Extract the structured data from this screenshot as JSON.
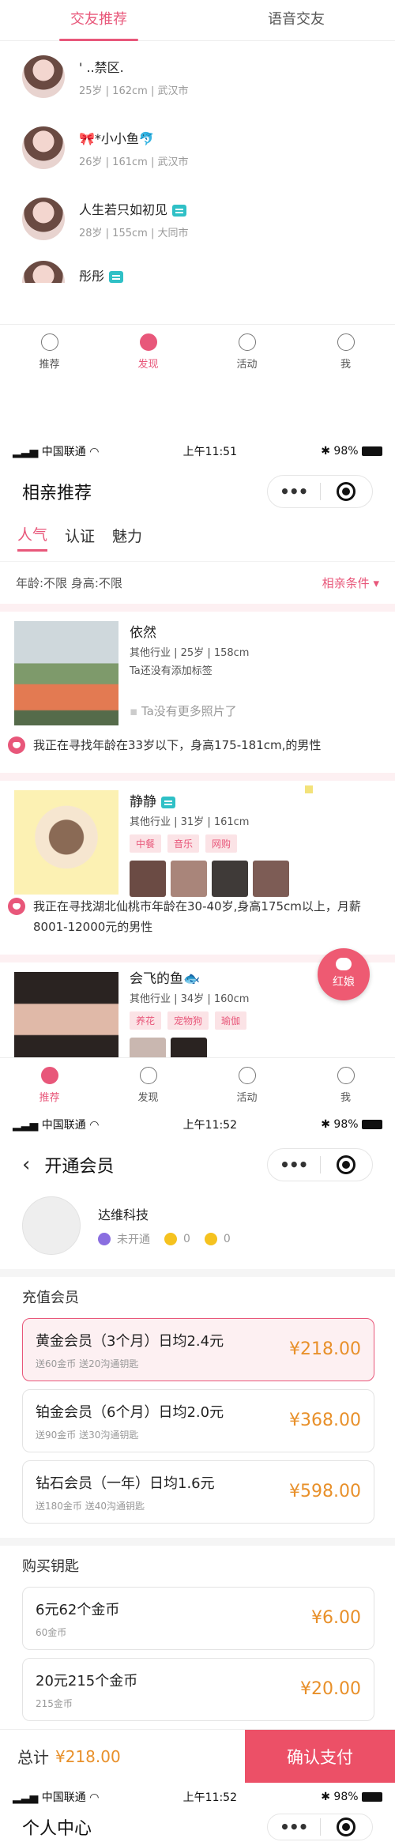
{
  "screen1": {
    "tabs": [
      "交友推荐",
      "语音交友"
    ],
    "users": [
      {
        "name": "' ..禁区.",
        "meta": "25岁 | 162cm | 武汉市",
        "vip": false
      },
      {
        "name": "🎀*小小鱼🐬",
        "meta": "26岁 | 161cm | 武汉市",
        "vip": false
      },
      {
        "name": "人生若只如初见",
        "meta": "28岁 | 155cm | 大同市",
        "vip": true
      },
      {
        "name": "彤彤",
        "meta": "",
        "vip": true
      }
    ],
    "tabbar": [
      "推荐",
      "发现",
      "活动",
      "我"
    ]
  },
  "screen2": {
    "status": {
      "carrier": "中国联通",
      "time": "上午11:51",
      "battery": "98%"
    },
    "title": "相亲推荐",
    "filter_tabs": [
      "人气",
      "认证",
      "魅力"
    ],
    "filter_text": "年龄:不限  身高:不限",
    "filter_button": "相亲条件",
    "cards": [
      {
        "name": "依然",
        "info": "其他行业 | 25岁 | 158cm",
        "note": "Ta还没有添加标签",
        "no_photos": "Ta没有更多照片了",
        "seek": "我正在寻找年龄在33岁以下，身高175-181cm,的男性"
      },
      {
        "name": "静静",
        "info": "其他行业 | 31岁 | 161cm",
        "tags": [
          "中餐",
          "音乐",
          "网购"
        ],
        "seek": "我正在寻找湖北仙桃市年龄在30-40岁,身高175cm以上，月薪8001-12000元的男性"
      },
      {
        "name": "会飞的鱼🐟",
        "info": "其他行业 | 34岁 | 160cm",
        "tags": [
          "养花",
          "宠物狗",
          "瑜伽"
        ]
      }
    ],
    "hongniang": "红娘",
    "tabbar": [
      "推荐",
      "发现",
      "活动",
      "我"
    ]
  },
  "screen3": {
    "status": {
      "carrier": "中国联通",
      "time": "上午11:52",
      "battery": "98%"
    },
    "title": "开通会员",
    "user_name": "达维科技",
    "member_status": "未开通",
    "gold": "0",
    "keys": "0",
    "section_vip": "充值会员",
    "packages": [
      {
        "title": "黄金会员（3个月）日均2.4元",
        "sub": "送60金币 送20沟通钥匙",
        "price": "¥218.00",
        "selected": true
      },
      {
        "title": "铂金会员（6个月）日均2.0元",
        "sub": "送90金币 送30沟通钥匙",
        "price": "¥368.00",
        "selected": false
      },
      {
        "title": "钻石会员（一年）日均1.6元",
        "sub": "送180金币 送40沟通钥匙",
        "price": "¥598.00",
        "selected": false
      }
    ],
    "section_keys": "购买钥匙",
    "key_packages": [
      {
        "title": "6元62个金币",
        "sub": "60金币",
        "price": "¥6.00"
      },
      {
        "title": "20元215个金币",
        "sub": "215金币",
        "price": "¥20.00"
      }
    ],
    "total_label": "总计",
    "total_value": "¥218.00",
    "pay_button": "确认支付"
  },
  "screen4": {
    "status": {
      "carrier": "中国联通",
      "time": "上午11:52",
      "battery": "98%"
    },
    "title": "个人中心"
  },
  "colors": {
    "accent": "#e8577a",
    "price": "#e8902a",
    "vip": "#2fc0c6"
  }
}
